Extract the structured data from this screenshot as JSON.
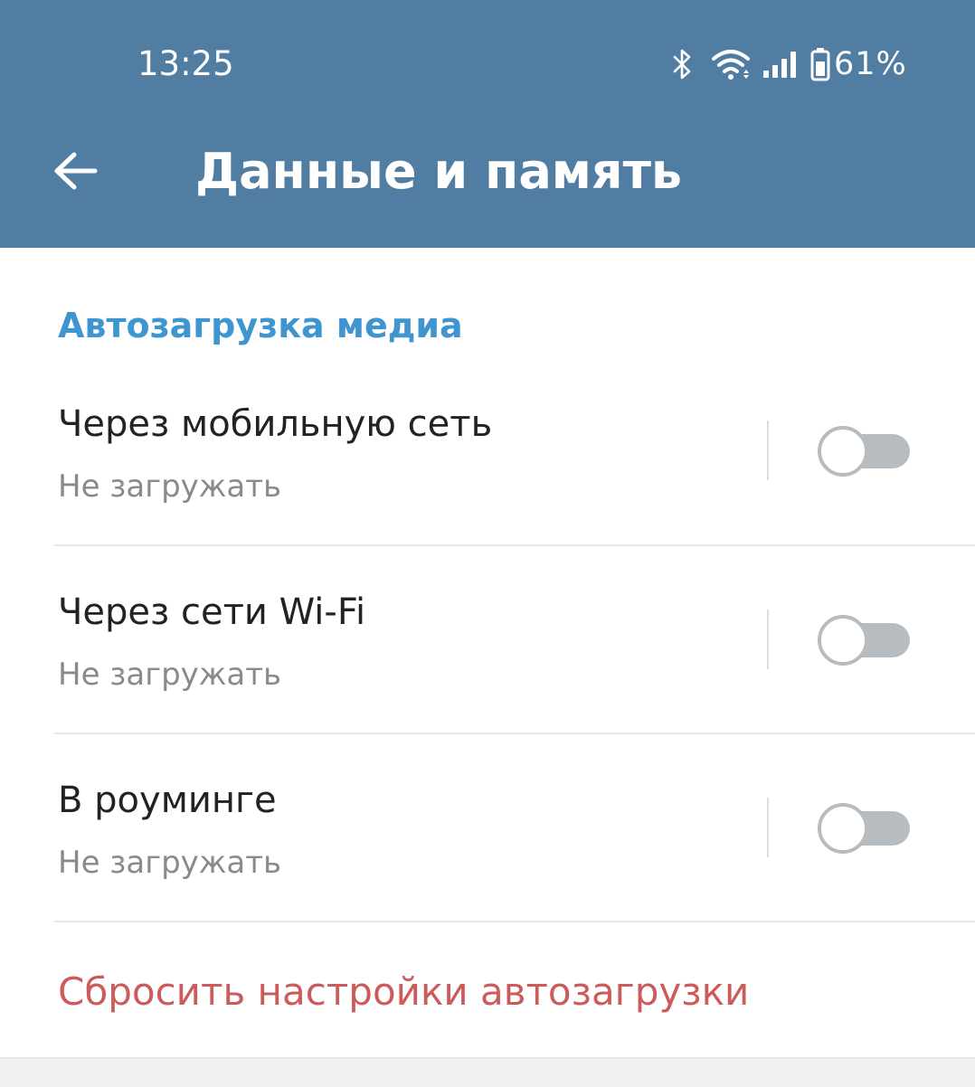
{
  "status_bar": {
    "time": "13:25",
    "battery_percent": "61%",
    "icons": [
      "bluetooth-icon",
      "wifi-icon",
      "cell-signal-icon",
      "battery-icon"
    ]
  },
  "toolbar": {
    "back_icon": "arrow-left-icon",
    "title": "Данные и память"
  },
  "section": {
    "title": "Автозагрузка медиа"
  },
  "items": [
    {
      "title": "Через мобильную сеть",
      "subtitle": "Не загружать",
      "enabled": false
    },
    {
      "title": "Через сети Wi-Fi",
      "subtitle": "Не загружать",
      "enabled": false
    },
    {
      "title": "В роуминге",
      "subtitle": "Не загружать",
      "enabled": false
    }
  ],
  "reset_label": "Сбросить настройки автозагрузки",
  "colors": {
    "header_bg": "#517da2",
    "section_accent": "#3e95cf",
    "reset_red": "#cc5b5b",
    "switch_off": "#b7bcc1"
  }
}
